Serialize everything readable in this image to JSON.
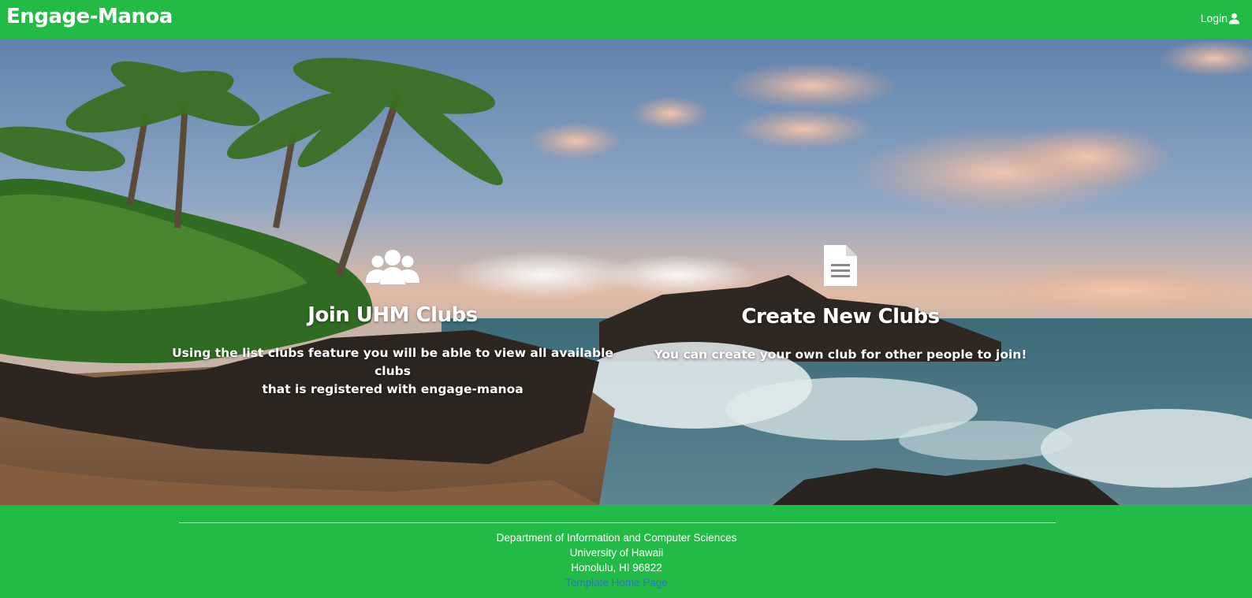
{
  "navbar": {
    "brand": "Engage-Manoa",
    "login_label": "Login",
    "login_icon": "user-icon"
  },
  "hero": {
    "background": "tropical-beach-photo",
    "features": [
      {
        "icon": "users-icon",
        "title": "Join UHM Clubs",
        "text_line1": "Using the list clubs feature you will be able to view all available clubs",
        "text_line2": "that is registered with engage-manoa"
      },
      {
        "icon": "file-text-icon",
        "title": "Create New Clubs",
        "text_line1": "You can create your own club for other people to join!"
      }
    ]
  },
  "footer": {
    "line1": "Department of Information and Computer Sciences",
    "line2": "University of Hawaii",
    "line3": "Honolulu, HI 96822",
    "link": "Template Home Page"
  },
  "colors": {
    "brand_green": "#21bb45",
    "text": "#ffffff",
    "link": "#2f6fd6"
  }
}
